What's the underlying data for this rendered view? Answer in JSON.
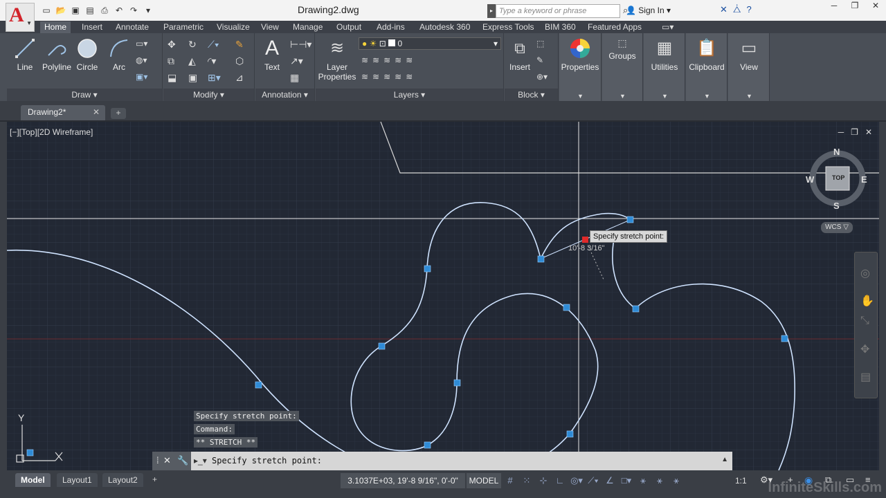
{
  "window": {
    "title": "Drawing2.dwg",
    "search_placeholder": "Type a keyword or phrase",
    "sign_in": "Sign In"
  },
  "ribbon_tabs": [
    "Home",
    "Insert",
    "Annotate",
    "Parametric",
    "Visualize",
    "View",
    "Manage",
    "Output",
    "Add-ins",
    "Autodesk 360",
    "Express Tools",
    "BIM 360",
    "Featured Apps"
  ],
  "ribbon": {
    "draw": {
      "title": "Draw",
      "tools": [
        "Line",
        "Polyline",
        "Circle",
        "Arc"
      ]
    },
    "modify": {
      "title": "Modify"
    },
    "annotation": {
      "title": "Annotation",
      "tools": [
        "Text"
      ]
    },
    "layers": {
      "title": "Layers",
      "layer_properties_l1": "Layer",
      "layer_properties_l2": "Properties",
      "current_layer": "0"
    },
    "block": {
      "title": "Block",
      "tools": [
        "Insert"
      ]
    },
    "properties": "Properties",
    "groups": "Groups",
    "utilities": "Utilities",
    "clipboard": "Clipboard",
    "view": "View"
  },
  "file_tab": {
    "name": "Drawing2*"
  },
  "viewport": {
    "label": "[−][Top][2D Wireframe]",
    "tooltip": "Specify stretch point:",
    "dimension": "10'-8 3/16\"",
    "compass": {
      "n": "N",
      "s": "S",
      "e": "E",
      "w": "W",
      "top": "TOP"
    },
    "wcs": "WCS ▽",
    "ucs_y": "Y"
  },
  "command_history": [
    "Specify stretch point:",
    "Command:",
    "** STRETCH **"
  ],
  "command_line": "Specify stretch point:",
  "layout_tabs": [
    "Model",
    "Layout1",
    "Layout2"
  ],
  "status": {
    "coords": "3.1037E+03, 19'-8 9/16\", 0'-0\"",
    "model": "MODEL",
    "scale": "1:1"
  },
  "watermark": "InfiniteSkills.com"
}
